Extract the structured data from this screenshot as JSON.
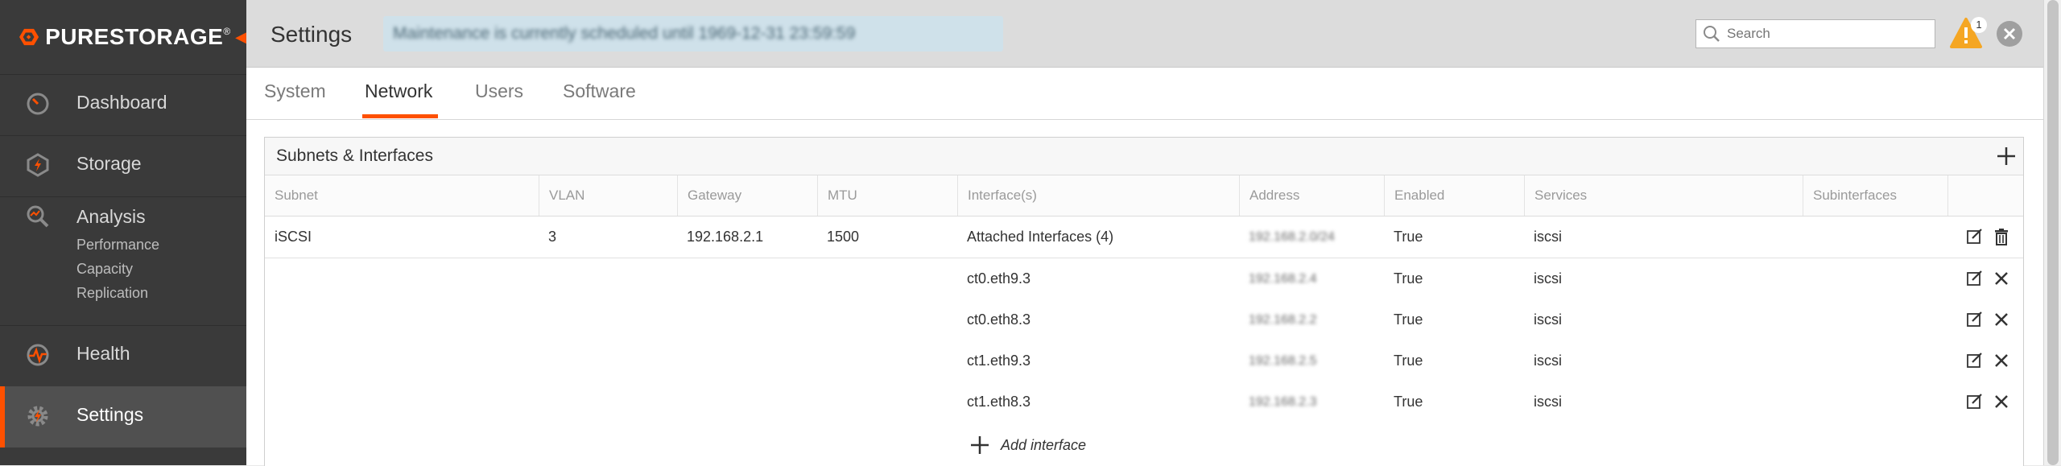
{
  "sidebar": {
    "brand": "PURESTORAGE",
    "brand_mark": "®",
    "items": [
      {
        "label": "Dashboard",
        "icon": "gauge-icon"
      },
      {
        "label": "Storage",
        "icon": "storage-hex-icon"
      },
      {
        "label": "Analysis",
        "icon": "analysis-magnifier-icon",
        "subitems": [
          "Performance",
          "Capacity",
          "Replication"
        ]
      },
      {
        "label": "Health",
        "icon": "health-pulse-icon"
      },
      {
        "label": "Settings",
        "icon": "gear-icon",
        "active": true
      }
    ]
  },
  "header": {
    "title": "Settings",
    "banner": "Maintenance is currently scheduled until 1969-12-31 23:59:59",
    "search_placeholder": "Search",
    "alert_count": "1"
  },
  "tabs": [
    {
      "label": "System"
    },
    {
      "label": "Network",
      "active": true
    },
    {
      "label": "Users"
    },
    {
      "label": "Software"
    }
  ],
  "panel": {
    "title": "Subnets & Interfaces",
    "columns": [
      "Subnet",
      "VLAN",
      "Gateway",
      "MTU",
      "Interface(s)",
      "Address",
      "Enabled",
      "Services",
      "Subinterfaces"
    ],
    "subnet_row": {
      "subnet": "iSCSI",
      "vlan": "3",
      "gateway": "192.168.2.1",
      "mtu": "1500",
      "interfaces": "Attached Interfaces (4)",
      "address": "192.168.2.0/24",
      "enabled": "True",
      "services": "iscsi",
      "subinterfaces": ""
    },
    "interface_rows": [
      {
        "interface": "ct0.eth9.3",
        "address": "192.168.2.4",
        "enabled": "True",
        "services": "iscsi"
      },
      {
        "interface": "ct0.eth8.3",
        "address": "192.168.2.2",
        "enabled": "True",
        "services": "iscsi"
      },
      {
        "interface": "ct1.eth9.3",
        "address": "192.168.2.5",
        "enabled": "True",
        "services": "iscsi"
      },
      {
        "interface": "ct1.eth8.3",
        "address": "192.168.2.3",
        "enabled": "True",
        "services": "iscsi"
      }
    ],
    "add_interface_label": "Add interface"
  },
  "colors": {
    "accent": "#fe5000",
    "sidebar": "#3a3a3a",
    "alert": "#f5a623"
  }
}
